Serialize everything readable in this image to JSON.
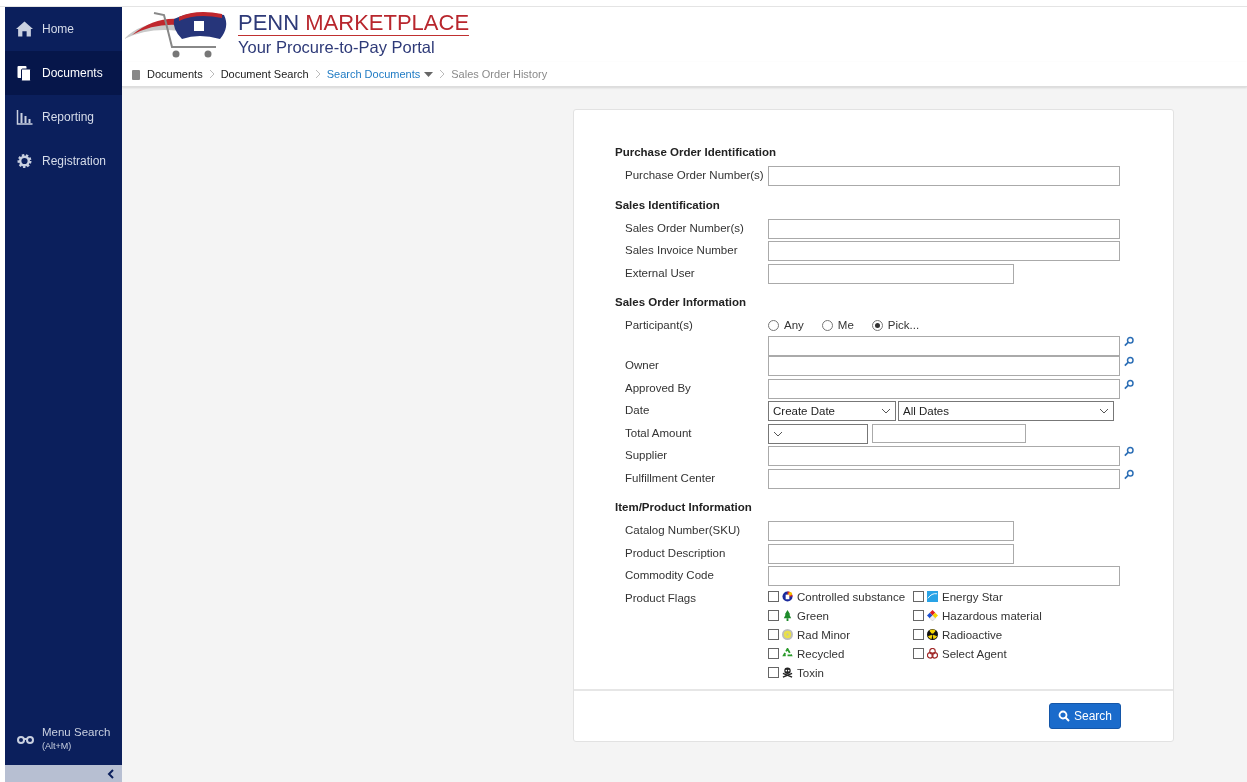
{
  "sidebar": {
    "items": [
      {
        "label": "Home",
        "kind": "home",
        "selected": false
      },
      {
        "label": "Documents",
        "kind": "documents",
        "selected": true
      },
      {
        "label": "Reporting",
        "kind": "reporting",
        "selected": false
      },
      {
        "label": "Registration",
        "kind": "registration",
        "selected": false
      }
    ],
    "menu_search": {
      "label": "Menu Search",
      "shortcut": "(Alt+M)"
    }
  },
  "logo": {
    "name_first": "PENN",
    "name_second": "MARKETPLACE",
    "tagline": "Your Procure-to-Pay Portal"
  },
  "breadcrumb": [
    {
      "label": "Documents",
      "kind": "root"
    },
    {
      "label": "Document Search",
      "kind": "plain"
    },
    {
      "label": "Search Documents",
      "kind": "menu"
    },
    {
      "label": "Sales Order History",
      "kind": "current"
    }
  ],
  "form": {
    "sections": [
      {
        "heading": "Purchase Order Identification",
        "rows": [
          {
            "label": "Purchase Order Number(s)",
            "kind": "field"
          }
        ]
      },
      {
        "heading": "Sales Identification",
        "rows": [
          {
            "label": "Sales Order Number(s)",
            "kind": "field"
          },
          {
            "label": "Sales Invoice Number",
            "kind": "field"
          },
          {
            "label": "External User",
            "kind": "short-field"
          }
        ]
      },
      {
        "heading": "Sales Order Information",
        "rows": [
          {
            "label": "Participant(s)",
            "kind": "radio-lookup",
            "options": [
              {
                "label": "Any",
                "selected": false
              },
              {
                "label": "Me",
                "selected": false
              },
              {
                "label": "Pick...",
                "selected": true
              }
            ]
          },
          {
            "label": "Owner",
            "kind": "lookup"
          },
          {
            "label": "Approved By",
            "kind": "lookup"
          },
          {
            "label": "Date",
            "kind": "date",
            "values": [
              "Create Date",
              "All Dates"
            ]
          },
          {
            "label": "Total Amount",
            "kind": "amount"
          },
          {
            "label": "Supplier",
            "kind": "lookup"
          },
          {
            "label": "Fulfillment Center",
            "kind": "lookup"
          }
        ]
      },
      {
        "heading": "Item/Product Information",
        "rows": [
          {
            "label": "Catalog Number(SKU)",
            "kind": "short-field"
          },
          {
            "label": "Product Description",
            "kind": "short-field"
          },
          {
            "label": "Commodity Code",
            "kind": "field"
          },
          {
            "label": "Product Flags",
            "kind": "flags",
            "flags": [
              {
                "label": "Controlled substance",
                "kind": "controlled",
                "checked": false
              },
              {
                "label": "Energy Star",
                "kind": "energy",
                "checked": false
              },
              {
                "label": "Green",
                "kind": "green",
                "checked": false
              },
              {
                "label": "Hazardous material",
                "kind": "hazard",
                "checked": false
              },
              {
                "label": "Rad Minor",
                "kind": "radminor",
                "checked": false
              },
              {
                "label": "Radioactive",
                "kind": "radioactive",
                "checked": false
              },
              {
                "label": "Recycled",
                "kind": "recycled",
                "checked": false
              },
              {
                "label": "Select Agent",
                "kind": "biohazard",
                "checked": false
              },
              {
                "label": "Toxin",
                "kind": "toxin",
                "checked": false
              }
            ]
          }
        ]
      }
    ],
    "search_button": "Search"
  }
}
